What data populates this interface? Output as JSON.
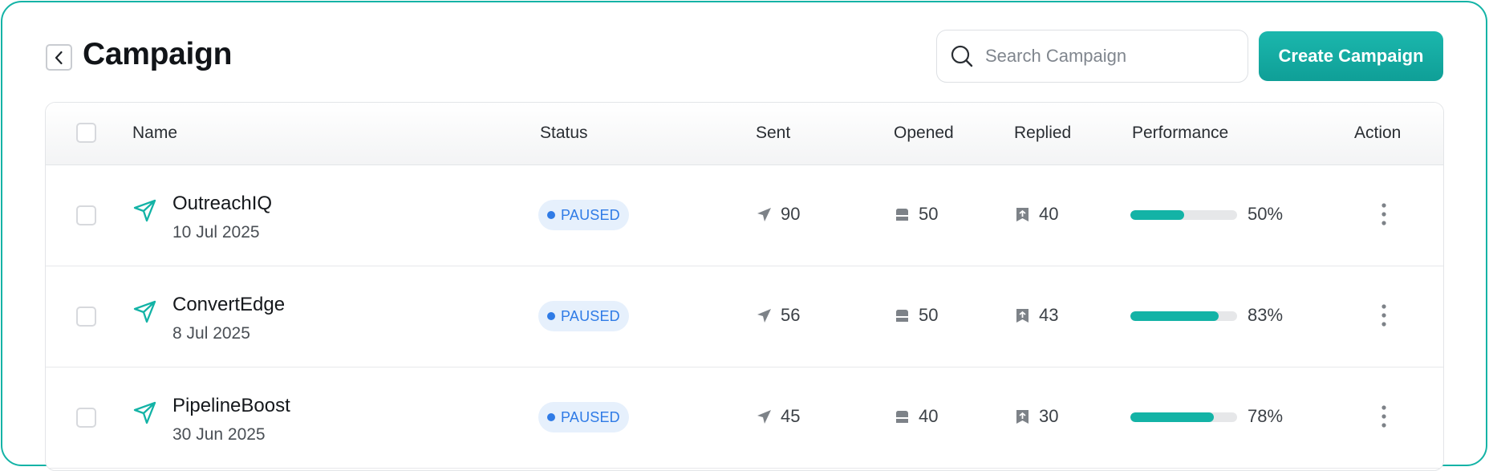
{
  "header": {
    "title": "Campaign",
    "search_placeholder": "Search Campaign",
    "search_value": "",
    "create_button_label": "Create Campaign"
  },
  "table": {
    "columns": [
      "Name",
      "Status",
      "Sent",
      "Opened",
      "Replied",
      "Performance",
      "Action"
    ],
    "rows": [
      {
        "name": "OutreachIQ",
        "date": "10 Jul 2025",
        "status": "PAUSED",
        "sent": "90",
        "opened": "50",
        "replied": "40",
        "performance_label": "50%",
        "performance": 0.5
      },
      {
        "name": "ConvertEdge",
        "date": "8 Jul 2025",
        "status": "PAUSED",
        "sent": "56",
        "opened": "50",
        "replied": "43",
        "performance_label": "83%",
        "performance": 0.83
      },
      {
        "name": "PipelineBoost",
        "date": "30 Jun 2025",
        "status": "PAUSED",
        "sent": "45",
        "opened": "40",
        "replied": "30",
        "performance_label": "78%",
        "performance": 0.78
      }
    ]
  },
  "icons": {
    "back": "chevron-left-icon",
    "search": "search-icon",
    "campaign": "paper-plane-icon",
    "sent": "send-icon",
    "opened": "mailbox-icon",
    "replied": "reply-icon",
    "action": "kebab-menu-icon"
  },
  "colors": {
    "accent": "#13b3a6",
    "status_paused_text": "#2f7be6",
    "status_paused_bg": "#e6f0fc"
  }
}
